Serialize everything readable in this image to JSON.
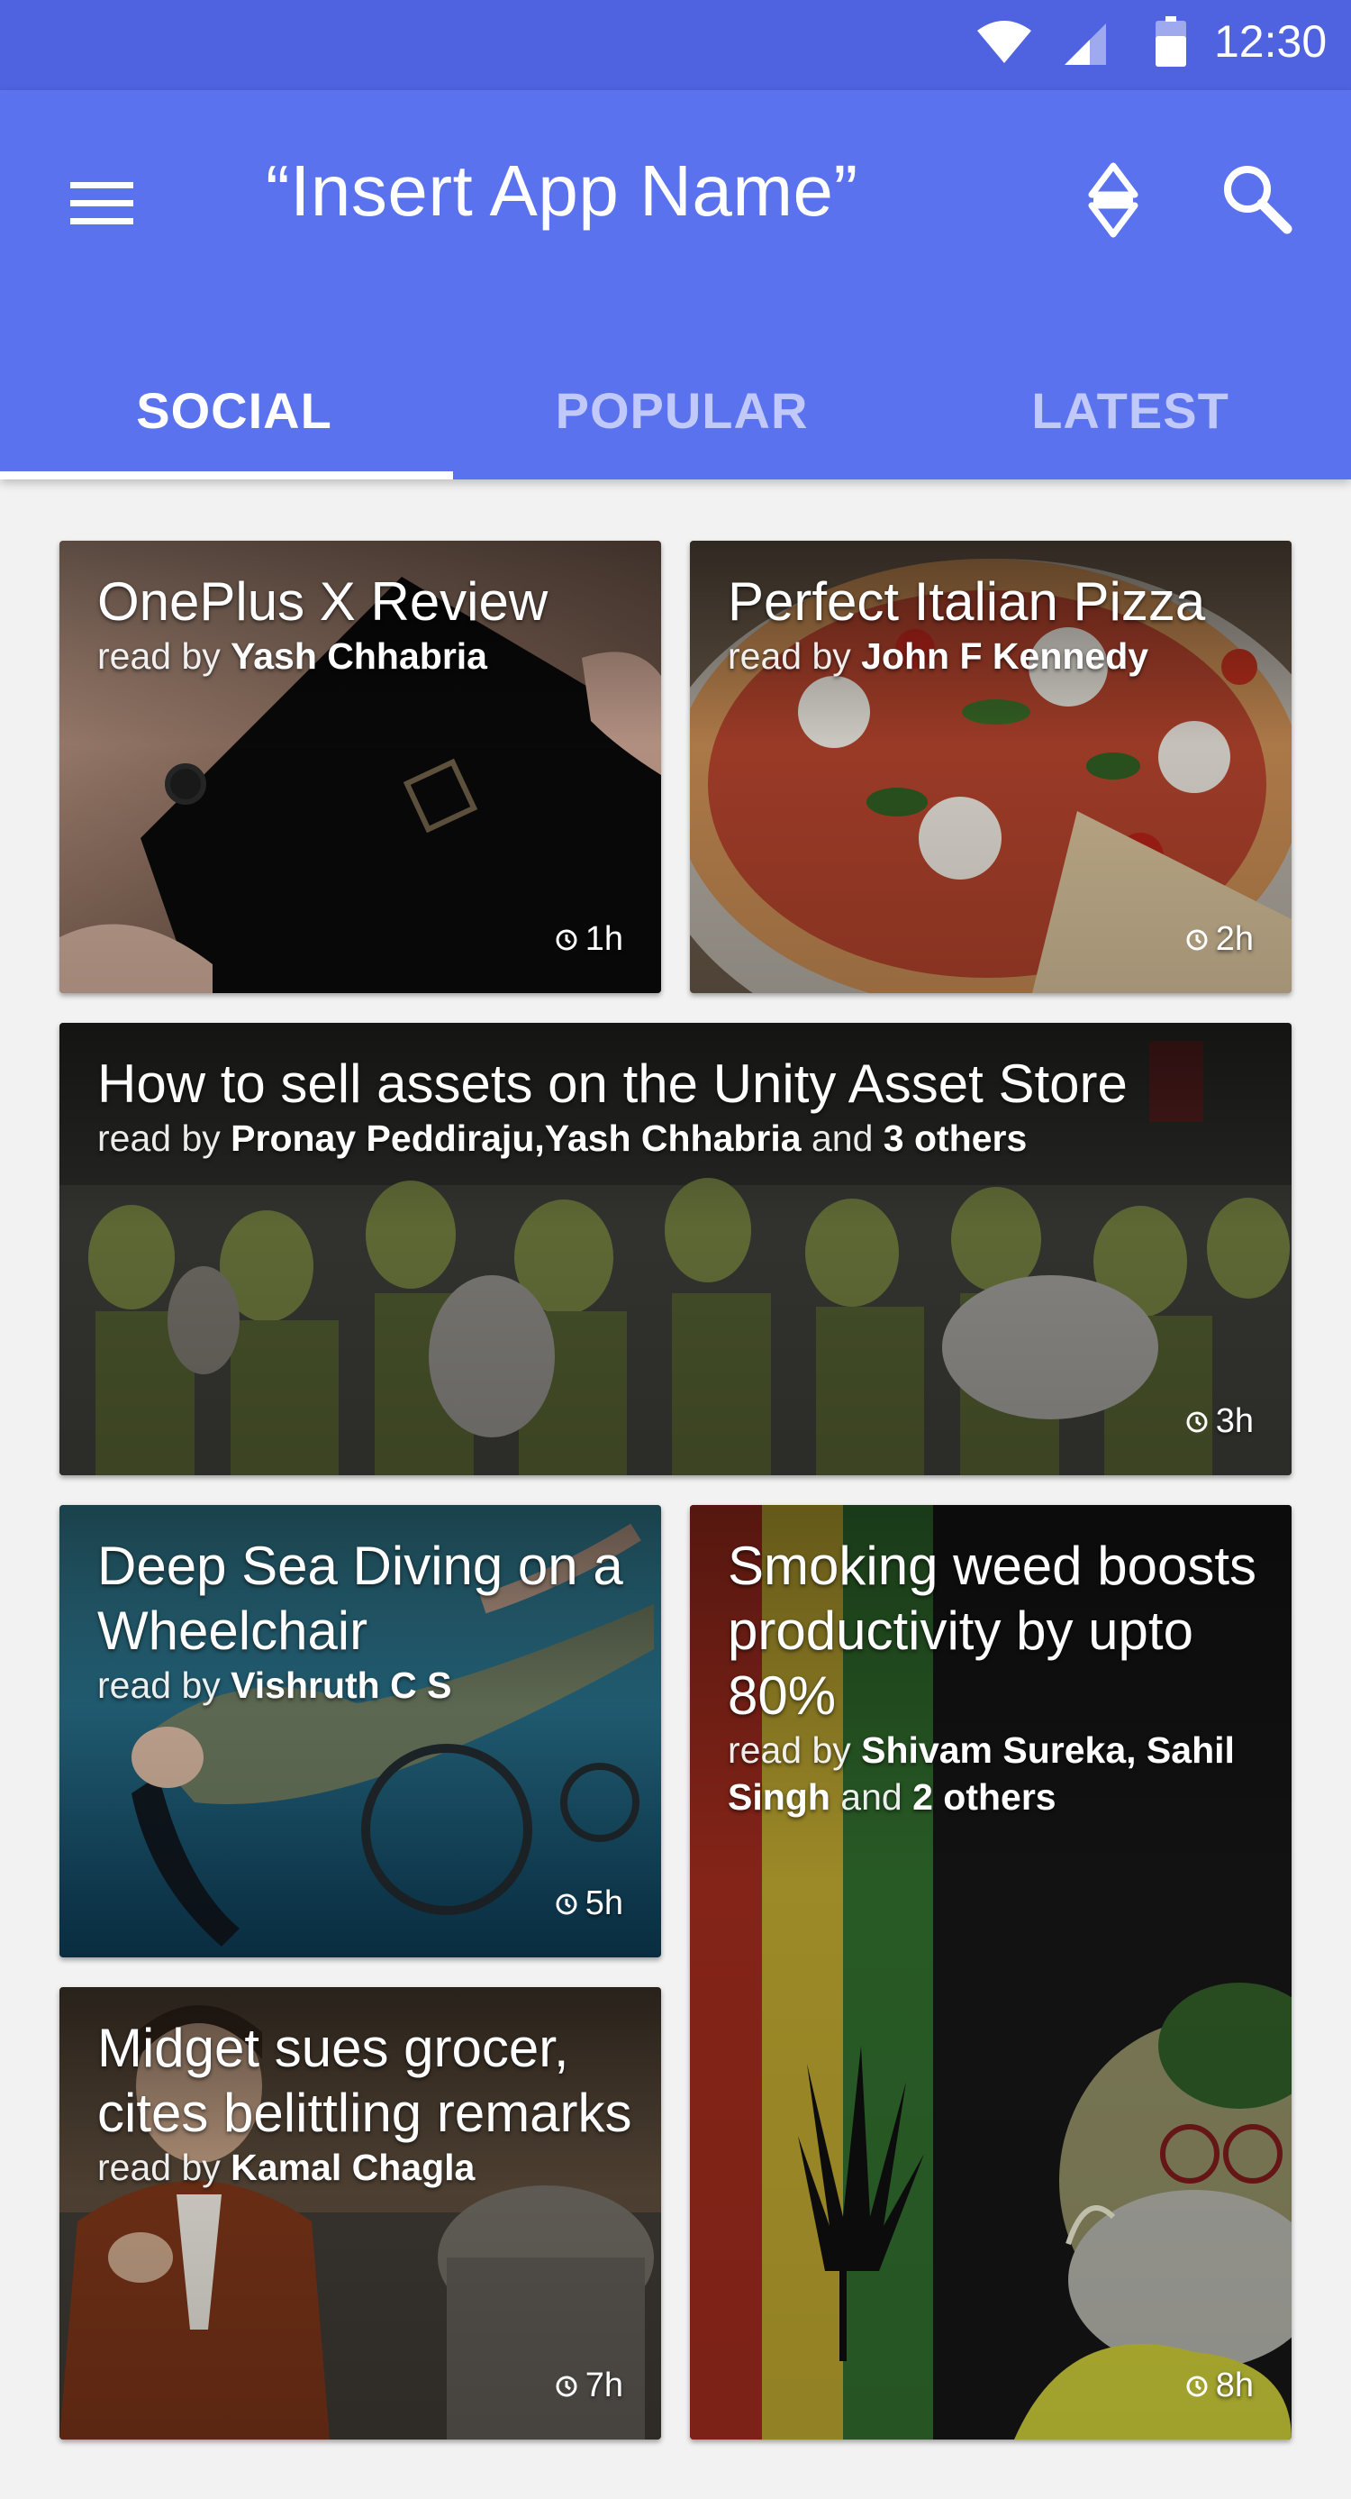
{
  "status_bar": {
    "time": "12:30"
  },
  "app_bar": {
    "title": "“Insert App Name”",
    "menu_icon": "hamburger-menu-icon",
    "sort_icon": "sort-arrows-icon",
    "search_icon": "search-icon"
  },
  "tabs": [
    {
      "label": "SOCIAL",
      "active": true
    },
    {
      "label": "POPULAR",
      "active": false
    },
    {
      "label": "LATEST",
      "active": false
    }
  ],
  "colors": {
    "status_bar": "#4f63e0",
    "app_bar": "#5b72ee",
    "background": "#f2f2f2"
  },
  "cards": [
    {
      "title": "OnePlus X Review",
      "read_by_prefix": "read by ",
      "readers": "Yash Chhabria",
      "read_by_suffix": "",
      "others": "",
      "time": "1h"
    },
    {
      "title": "Perfect Italian Pizza",
      "read_by_prefix": "read by ",
      "readers": "John F Kennedy",
      "read_by_suffix": "",
      "others": "",
      "time": "2h"
    },
    {
      "title": "How to sell assets on the Unity Asset Store",
      "read_by_prefix": "read by ",
      "readers": "Pronay Peddiraju,Yash Chhabria",
      "read_by_suffix": " and ",
      "others": "3 others",
      "time": "3h"
    },
    {
      "title": "Deep Sea Diving on a Wheelchair",
      "read_by_prefix": "read by ",
      "readers": "Vishruth C S",
      "read_by_suffix": "",
      "others": "",
      "time": "5h"
    },
    {
      "title": "Smoking weed boosts productivity by upto 80%",
      "read_by_prefix": "read by ",
      "readers": "Shivam Sureka, Sahil Singh",
      "read_by_suffix": " and ",
      "others": "2 others",
      "time": "8h"
    },
    {
      "title": "Midget sues grocer, cites belittling remarks",
      "read_by_prefix": "read by ",
      "readers": "Kamal Chagla",
      "read_by_suffix": "",
      "others": "",
      "time": "7h"
    }
  ]
}
